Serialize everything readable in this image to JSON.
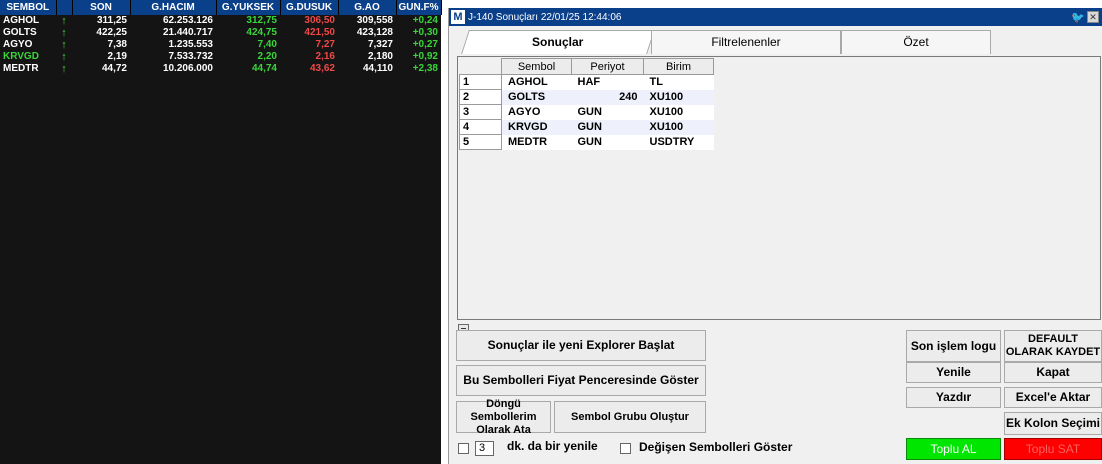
{
  "market": {
    "columns": [
      "SEMBOL",
      "",
      "SON",
      "G.HACIM",
      "G.YUKSEK",
      "G.DUSUK",
      "G.AO",
      "GUN.F%"
    ],
    "rows": [
      {
        "sembol": "AGHOL",
        "son": "311,25",
        "hacim": "62.253.126",
        "yuksek": "312,75",
        "dusuk": "306,50",
        "ao": "309,558",
        "gunf": "+0,24"
      },
      {
        "sembol": "GOLTS",
        "son": "422,25",
        "hacim": "21.440.717",
        "yuksek": "424,75",
        "dusuk": "421,50",
        "ao": "423,128",
        "gunf": "+0,30"
      },
      {
        "sembol": "AGYO",
        "son": "7,38",
        "hacim": "1.235.553",
        "yuksek": "7,40",
        "dusuk": "7,27",
        "ao": "7,327",
        "gunf": "+0,27"
      },
      {
        "sembol": "KRVGD",
        "son": "2,19",
        "hacim": "7.533.732",
        "yuksek": "2,20",
        "dusuk": "2,16",
        "ao": "2,180",
        "gunf": "+0,92"
      },
      {
        "sembol": "MEDTR",
        "son": "44,72",
        "hacim": "10.206.000",
        "yuksek": "44,74",
        "dusuk": "43,62",
        "ao": "44,110",
        "gunf": "+2,38"
      }
    ],
    "arrow_icon": "up-arrow-icon",
    "colors": {
      "up": "#3ad53a",
      "down": "#f04848",
      "header_bg": "#0a3f8a"
    }
  },
  "window": {
    "logo": "M",
    "title": "J-140 Sonuçları 22/01/25 12:44:06",
    "tabs": [
      "Sonuçlar",
      "Filtrelenenler",
      "Özet"
    ],
    "active_tab": "Sonuçlar",
    "grid": {
      "columns": [
        "Sembol",
        "Periyot",
        "Birim"
      ],
      "rows": [
        {
          "n": "1",
          "sembol": "AGHOL",
          "periyot": "HAF",
          "birim": "TL"
        },
        {
          "n": "2",
          "sembol": "GOLTS",
          "periyot": "240",
          "birim": "XU100"
        },
        {
          "n": "3",
          "sembol": "AGYO",
          "periyot": "GUN",
          "birim": "XU100"
        },
        {
          "n": "4",
          "sembol": "KRVGD",
          "periyot": "GUN",
          "birim": "XU100"
        },
        {
          "n": "5",
          "sembol": "MEDTR",
          "periyot": "GUN",
          "birim": "USDTRY"
        }
      ]
    },
    "buttons": {
      "explorer": "Sonuçlar ile yeni Explorer Başlat",
      "fiyat": "Bu Sembolleri Fiyat Penceresinde Göster",
      "dongu": "Döngü Sembollerim Olarak Ata",
      "grup": "Sembol Grubu Oluştur",
      "son_islem": "Son işlem logu",
      "default": "DEFAULT OLARAK KAYDET",
      "yenile": "Yenile",
      "kapat": "Kapat",
      "yazdir": "Yazdır",
      "excel": "Excel'e Aktar",
      "ek_kolon": "Ek Kolon Seçimi",
      "toplu_al": "Toplu AL",
      "toplu_sat": "Toplu SAT"
    },
    "refresh_minutes": "3",
    "refresh_label": "dk. da bir yenile",
    "changed_label": "Değişen Sembolleri Göster",
    "colors": {
      "al": "#00e600",
      "sat": "#ff0000"
    }
  }
}
